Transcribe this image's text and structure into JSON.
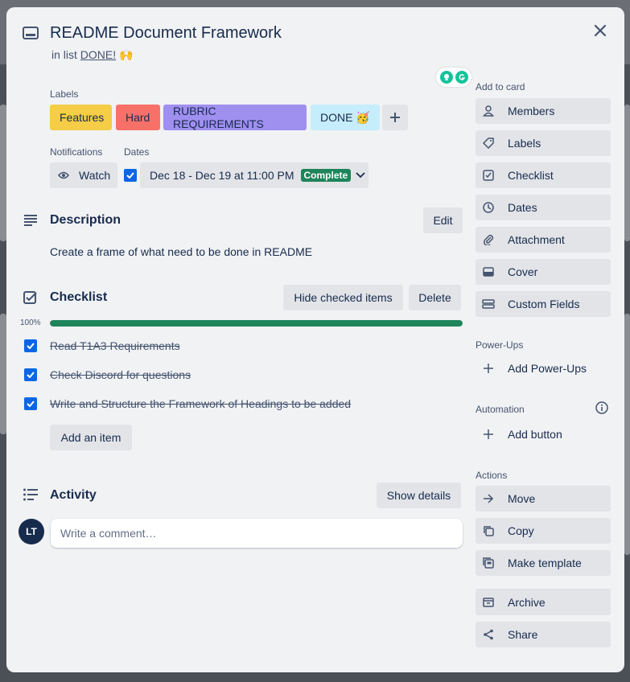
{
  "card": {
    "title": "README Document Framework",
    "in_list_prefix": "in list",
    "list_name": "DONE!",
    "list_emoji": "🙌"
  },
  "labels_section": {
    "heading": "Labels",
    "labels": [
      {
        "text": "Features",
        "color": "#f5cd47"
      },
      {
        "text": "Hard",
        "color": "#f87168"
      },
      {
        "text": "RUBRIC REQUIREMENTS",
        "color": "#9f8fef"
      },
      {
        "text": "DONE 🥳",
        "color": "#c6edfb"
      }
    ]
  },
  "notifications": {
    "heading": "Notifications",
    "watch_label": "Watch"
  },
  "dates": {
    "heading": "Dates",
    "range": "Dec 18 - Dec 19 at 11:00 PM",
    "status": "Complete"
  },
  "description": {
    "title": "Description",
    "edit_label": "Edit",
    "text": "Create a frame of what need to be done in README"
  },
  "checklist": {
    "title": "Checklist",
    "hide_label": "Hide checked items",
    "delete_label": "Delete",
    "percent_text": "100%",
    "progress": 1.0,
    "items": [
      {
        "text": "Read T1A3 Requirements",
        "checked": true
      },
      {
        "text": "Check Discord for questions",
        "checked": true
      },
      {
        "text": "Write and Structure the Framework of Headings to be added",
        "checked": true
      }
    ],
    "add_item_label": "Add an item"
  },
  "activity": {
    "title": "Activity",
    "show_details_label": "Show details",
    "avatar_initials": "LT",
    "comment_placeholder": "Write a comment…"
  },
  "sidebar": {
    "add_to_card": {
      "heading": "Add to card",
      "items": [
        {
          "label": "Members",
          "icon": "person-icon"
        },
        {
          "label": "Labels",
          "icon": "tag-icon"
        },
        {
          "label": "Checklist",
          "icon": "checklist-icon"
        },
        {
          "label": "Dates",
          "icon": "clock-icon"
        },
        {
          "label": "Attachment",
          "icon": "paperclip-icon"
        },
        {
          "label": "Cover",
          "icon": "card-cover-icon"
        },
        {
          "label": "Custom Fields",
          "icon": "custom-fields-icon"
        }
      ]
    },
    "power_ups": {
      "heading": "Power-Ups",
      "add_label": "Add Power-Ups"
    },
    "automation": {
      "heading": "Automation",
      "add_label": "Add button"
    },
    "actions": {
      "heading": "Actions",
      "items": [
        {
          "label": "Move",
          "icon": "arrow-right-icon"
        },
        {
          "label": "Copy",
          "icon": "copy-icon"
        },
        {
          "label": "Make template",
          "icon": "template-icon"
        },
        {
          "label": "Archive",
          "icon": "archive-icon"
        },
        {
          "label": "Share",
          "icon": "share-icon"
        }
      ]
    }
  },
  "colors": {
    "accent_blue": "#0c66e4",
    "complete_green": "#1f845a",
    "modal_bg": "#f1f2f4",
    "button_bg": "#e2e4e8"
  }
}
